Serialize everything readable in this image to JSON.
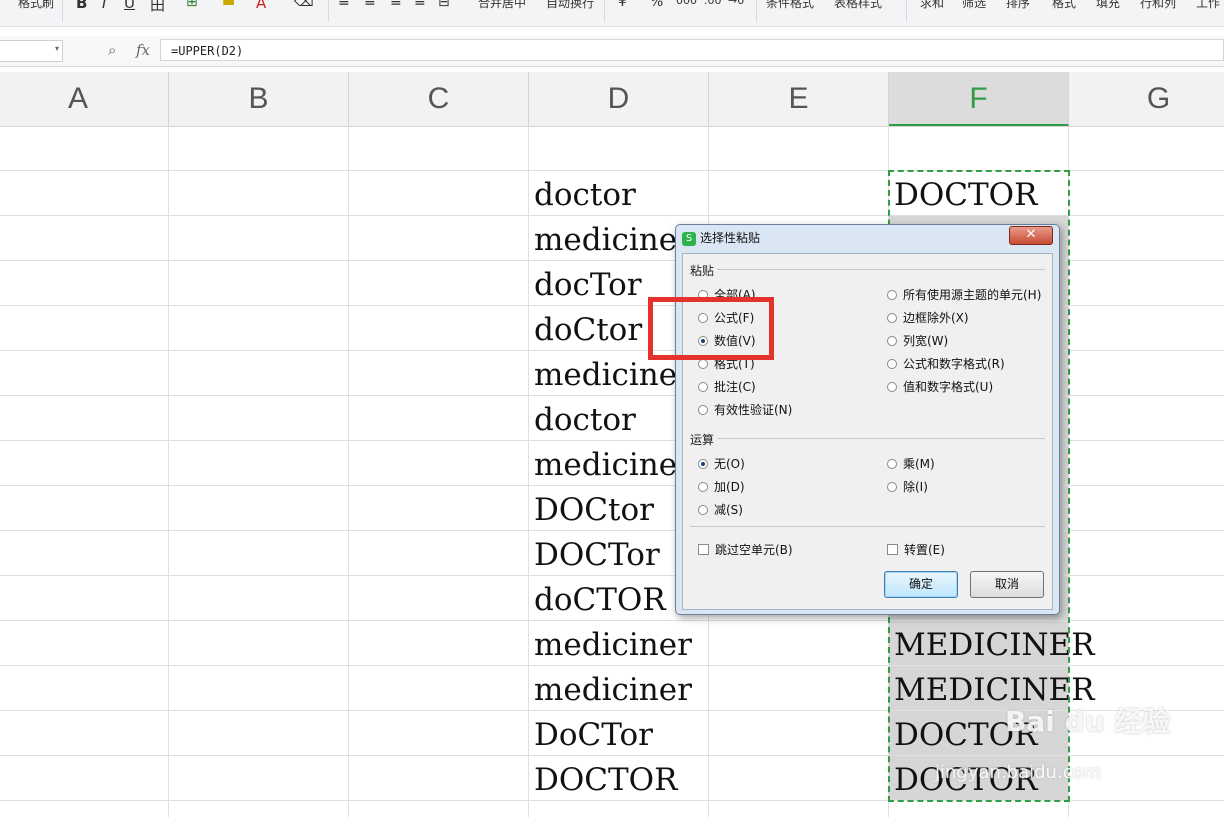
{
  "toolbar": {
    "items": [
      "格式刷",
      "B",
      "I",
      "U",
      "田",
      "合并居中",
      "自动换行",
      "¥",
      "%",
      "条件格式",
      "表格样式",
      "求和",
      "筛选",
      "排序",
      "格式",
      "填充",
      "行和列",
      "工作"
    ]
  },
  "formula_bar": {
    "name_box": "",
    "fx_label": "fx",
    "formula": "=UPPER(D2)"
  },
  "columns": [
    "A",
    "B",
    "C",
    "D",
    "E",
    "F",
    "G"
  ],
  "active_column": "F",
  "column_d": [
    "doctor",
    "medicine",
    "docTor",
    "doCtor",
    "medicine",
    "doctor",
    "medicine",
    "DOCtor",
    "DOCTor",
    "doCTOR",
    "mediciner",
    "mediciner",
    "DoCTor",
    "DOCTOR"
  ],
  "column_f_visible": {
    "r2": "DOCTOR",
    "r12": "MEDICINER",
    "r13": "MEDICINER",
    "r14": "DOCTOR",
    "r15": "DOCTOR"
  },
  "dialog": {
    "title": "选择性粘贴",
    "close": "✕",
    "paste_group": "粘贴",
    "paste_left": [
      {
        "label": "全部(A)",
        "checked": false
      },
      {
        "label": "公式(F)",
        "checked": false
      },
      {
        "label": "数值(V)",
        "checked": true
      },
      {
        "label": "格式(T)",
        "checked": false
      },
      {
        "label": "批注(C)",
        "checked": false
      },
      {
        "label": "有效性验证(N)",
        "checked": false
      }
    ],
    "paste_right": [
      {
        "label": "所有使用源主题的单元(H)",
        "checked": false
      },
      {
        "label": "边框除外(X)",
        "checked": false
      },
      {
        "label": "列宽(W)",
        "checked": false
      },
      {
        "label": "公式和数字格式(R)",
        "checked": false
      },
      {
        "label": "值和数字格式(U)",
        "checked": false
      }
    ],
    "op_group": "运算",
    "op_left": [
      {
        "label": "无(O)",
        "checked": true
      },
      {
        "label": "加(D)",
        "checked": false
      },
      {
        "label": "减(S)",
        "checked": false
      }
    ],
    "op_right": [
      {
        "label": "乘(M)",
        "checked": false
      },
      {
        "label": "除(I)",
        "checked": false
      }
    ],
    "skip_blanks": "跳过空单元(B)",
    "transpose": "转置(E)",
    "ok": "确定",
    "cancel": "取消"
  },
  "watermark": {
    "brand": "Bai du 经验",
    "url": "jingyan.baidu.com"
  },
  "colors": {
    "selection": "#2f9e47",
    "highlight": "#e5322d",
    "active_header_text": "#2e9d46"
  }
}
